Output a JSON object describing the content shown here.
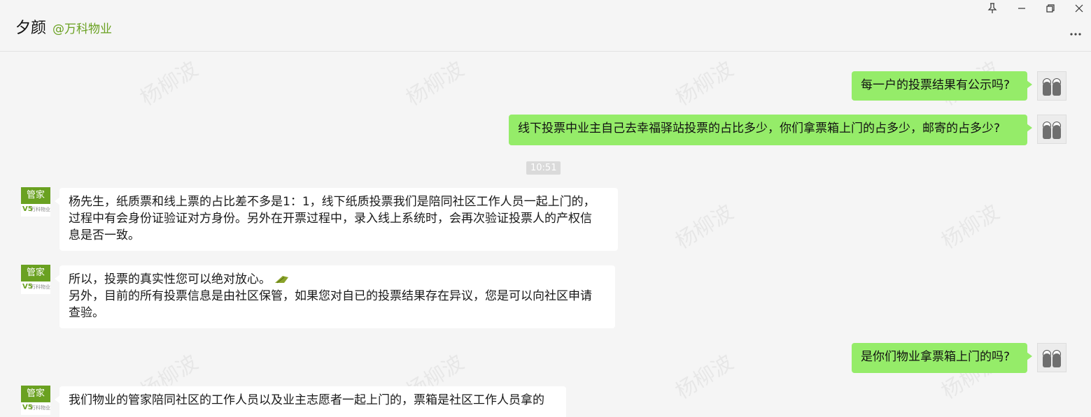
{
  "header": {
    "chat_name": "夕颜",
    "org_tag": "@万科物业"
  },
  "window": {
    "pin_icon": "pin-icon",
    "minimize_icon": "minimize-icon",
    "restore_icon": "restore-icon",
    "close_icon": "close-icon",
    "more_icon": "more-icon"
  },
  "watermark_text": "杨柳波",
  "bot_avatar": {
    "label": "管家",
    "logo_mark": "V5",
    "logo_text": "万科物业"
  },
  "timestamp": "10:51",
  "messages": [
    {
      "from": "me",
      "text": "每一户的投票结果有公示吗?"
    },
    {
      "from": "me",
      "text": "线下投票中业主自己去幸福驿站投票的占比多少，你们拿票箱上门的占多少，邮寄的占多少?"
    },
    {
      "from": "bot",
      "lines": [
        "杨先生，纸质票和线上票的占比差不多是1：1，线下纸质投票我们是陪同社区工作人员一起上门的，",
        "过程中有会身份证验证对方身份。另外在开票过程中，录入线上系统时，会再次验证投票人的产权信",
        "息是否一致。"
      ]
    },
    {
      "from": "bot",
      "lines": [
        "所以，投票的真实性您可以绝对放心。",
        "另外，目前的所有投票信息是由社区保管，如果您对自已的投票结果存在异议，您是可以向社区申请",
        "查验。"
      ]
    },
    {
      "from": "me",
      "text": "是你们物业拿票箱上门的吗?"
    },
    {
      "from": "bot",
      "lines": [
        "我们物业的管家陪同社区的工作人员以及业主志愿者一起上门的，票箱是社区工作人员拿的"
      ]
    }
  ]
}
